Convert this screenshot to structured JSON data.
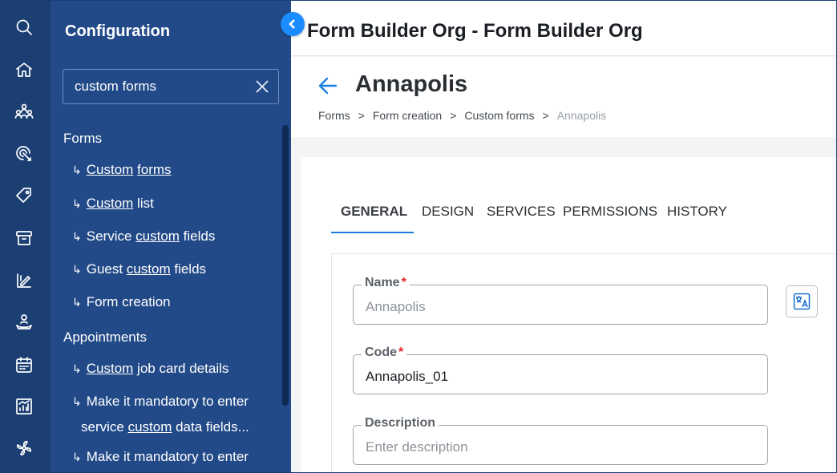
{
  "sidebar_rail": {
    "icons": [
      "search-icon",
      "home-icon",
      "team-icon",
      "target-icon",
      "tag-icon",
      "archive-icon",
      "reports-edit-icon",
      "services-icon",
      "calendar-icon",
      "analytics-icon",
      "fan-icon"
    ]
  },
  "config": {
    "title": "Configuration",
    "search": {
      "value": "custom forms",
      "placeholder": ""
    },
    "groups": [
      {
        "title": "Forms",
        "items": [
          {
            "pre": "",
            "match": "Custom",
            "mid": " ",
            "match2": "forms",
            "post": ""
          },
          {
            "pre": "",
            "match": "Custom",
            "mid": " list",
            "match2": "",
            "post": ""
          },
          {
            "pre": "Service ",
            "match": "custom",
            "mid": " fields",
            "match2": "",
            "post": ""
          },
          {
            "pre": "Guest ",
            "match": "custom",
            "mid": " fields",
            "match2": "",
            "post": ""
          },
          {
            "pre": "Form creation",
            "match": "",
            "mid": "",
            "match2": "",
            "post": ""
          }
        ]
      },
      {
        "title": "Appointments",
        "items": [
          {
            "pre": "",
            "match": "Custom",
            "mid": " job card details",
            "match2": "",
            "post": ""
          },
          {
            "pre": "Make it mandatory to enter",
            "match": "",
            "mid": "",
            "match2": "",
            "post": ""
          },
          {
            "pre": "service ",
            "match": "custom",
            "mid": " data fields...",
            "match2": "",
            "post": ""
          },
          {
            "pre": "Make it mandatory to enter",
            "match": "",
            "mid": "",
            "match2": "",
            "post": ""
          }
        ]
      }
    ],
    "arrow_glyph": "↳"
  },
  "topbar": {
    "org_title": "Form Builder Org - Form Builder Org"
  },
  "header": {
    "title": "Annapolis",
    "breadcrumb": [
      "Forms",
      "Form creation",
      "Custom forms",
      "Annapolis"
    ],
    "separator": ">"
  },
  "tabs": [
    "GENERAL",
    "DESIGN",
    "SERVICES",
    "PERMISSIONS",
    "HISTORY"
  ],
  "active_tab": "GENERAL",
  "form": {
    "name": {
      "label": "Name",
      "required_mark": "*",
      "value": "Annapolis"
    },
    "code": {
      "label": "Code",
      "required_mark": "*",
      "value": "Annapolis_01"
    },
    "description": {
      "label": "Description",
      "placeholder": "Enter description",
      "value": ""
    }
  },
  "colors": {
    "rail": "#1b3f73",
    "panel": "#224a88",
    "accent": "#1a7fe0",
    "required": "#e02828"
  }
}
